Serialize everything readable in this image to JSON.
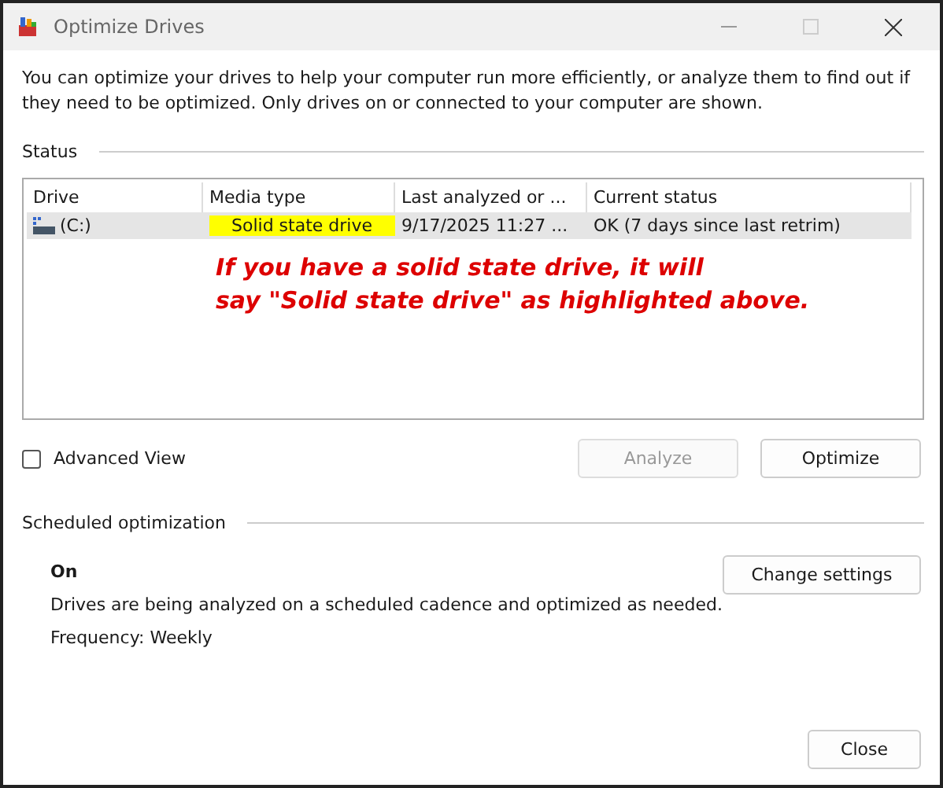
{
  "window": {
    "title": "Optimize Drives"
  },
  "intro": "You can optimize your drives to help your computer run more efficiently, or analyze them to find out if they need to be optimized. Only drives on or connected to your computer are shown.",
  "status": {
    "heading": "Status",
    "table": {
      "columns": [
        "Drive",
        "Media type",
        "Last analyzed or ...",
        "Current status"
      ],
      "rows": [
        {
          "selected": true,
          "cells": [
            {
              "text": "(C:)",
              "highlighted": false
            },
            {
              "text": "Solid state drive",
              "highlighted": true
            },
            {
              "text": "9/17/2025 11:27 ...",
              "highlighted": false
            },
            {
              "text": "OK (7 days since last retrim)",
              "highlighted": false
            }
          ]
        }
      ]
    },
    "annotation": [
      "If you have a solid state drive, it will",
      "say \"Solid state drive\" as highlighted above."
    ]
  },
  "advanced_view": {
    "label": "Advanced View",
    "checked": false
  },
  "buttons": [
    {
      "label": "Analyze",
      "disabled": true
    },
    {
      "label": "Optimize",
      "disabled": false
    }
  ],
  "scheduled": {
    "heading": "Scheduled optimization",
    "state": "On",
    "description": "Drives are being analyzed on a scheduled cadence and optimized as needed.",
    "frequency": "Frequency: Weekly",
    "button": "Change settings"
  },
  "close_button": "Close"
}
